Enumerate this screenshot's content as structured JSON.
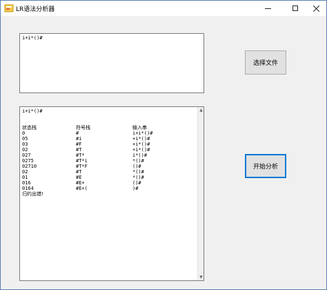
{
  "window": {
    "title": "LR语法分析器"
  },
  "input": {
    "text": "i+i*()#"
  },
  "output": {
    "first_line": "i+i*()#",
    "headers": [
      "状态栈",
      "符号栈",
      "输入串"
    ],
    "rows": [
      {
        "state": "0",
        "symbol": "#",
        "input": "i+i*()#"
      },
      {
        "state": "05",
        "symbol": "#i",
        "input": "+i*()#"
      },
      {
        "state": "03",
        "symbol": "#F",
        "input": "+i*()#"
      },
      {
        "state": "02",
        "symbol": "#T",
        "input": "+i*()#"
      },
      {
        "state": "027",
        "symbol": "#T*",
        "input": "i*()#"
      },
      {
        "state": "0275",
        "symbol": "#T*i",
        "input": "*()#"
      },
      {
        "state": "02710",
        "symbol": "#T*F",
        "input": "()#"
      },
      {
        "state": "02",
        "symbol": "#T",
        "input": "*()#"
      },
      {
        "state": "01",
        "symbol": "#E",
        "input": "*()#"
      },
      {
        "state": "016",
        "symbol": "#E+",
        "input": "()#"
      },
      {
        "state": "0164",
        "symbol": "#E+(",
        "input": ")#"
      }
    ],
    "error_text": "归约出错!"
  },
  "buttons": {
    "select_file": "选择文件",
    "start_analysis": "开始分析"
  },
  "colors": {
    "accent": "#0078d7",
    "window_bg": "#f0f0f0"
  }
}
